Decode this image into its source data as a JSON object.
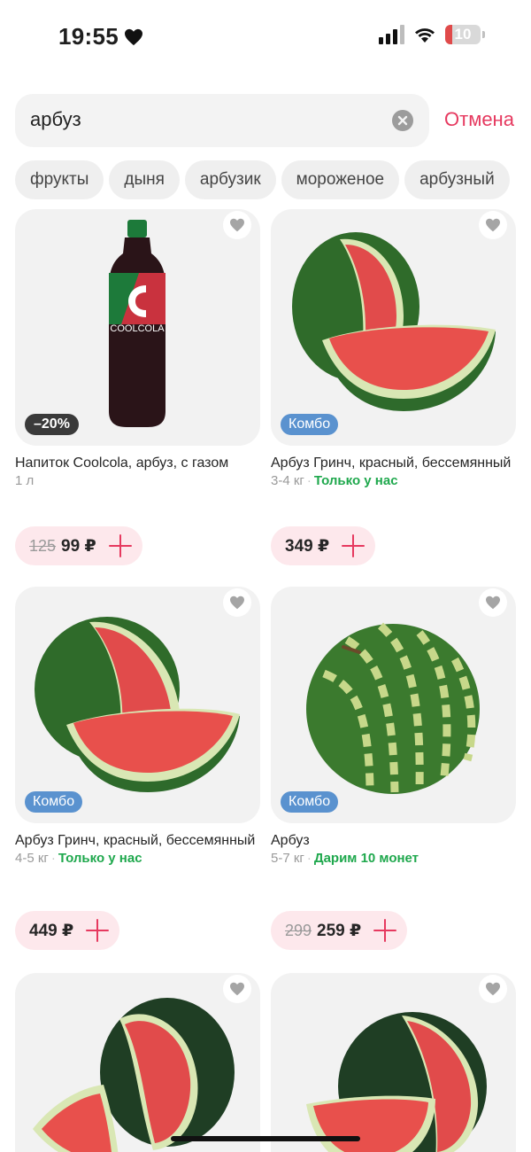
{
  "status_bar": {
    "time": "19:55",
    "battery": "10"
  },
  "search": {
    "query": "арбуз",
    "cancel_label": "Отмена"
  },
  "chips": [
    "фрукты",
    "дыня",
    "арбузик",
    "мороженое",
    "арбузный"
  ],
  "products": [
    {
      "name": "Напиток Coolcola, арбуз, с газом",
      "volume": "1 л",
      "badge": "–20%",
      "old_price": "125",
      "price": "99 ₽",
      "image_icon": "coolcola-bottle"
    },
    {
      "name": "Арбуз Гринч, красный, бессемянный",
      "weight": "3-4 кг",
      "promo": "Только у нас",
      "badge": "Комбо",
      "price": "349 ₽",
      "image_icon": "watermelon-sliced"
    },
    {
      "name": "Арбуз Гринч, красный, бессемянный",
      "weight": "4-5 кг",
      "promo": "Только у нас",
      "badge": "Комбо",
      "price": "449 ₽",
      "image_icon": "watermelon-sliced"
    },
    {
      "name": "Арбуз",
      "weight": "5-7 кг",
      "promo": "Дарим 10 монет",
      "badge": "Комбо",
      "old_price": "299",
      "price": "259 ₽",
      "image_icon": "watermelon-striped"
    },
    {
      "image_icon": "watermelon-dark-cut"
    },
    {
      "image_icon": "watermelon-dark-cut"
    }
  ],
  "colors": {
    "accent": "#e6395f",
    "promo_green": "#1fa84d",
    "combo_blue": "#5a92cf",
    "price_pill": "#fde8ec"
  }
}
